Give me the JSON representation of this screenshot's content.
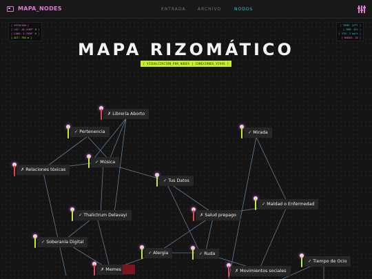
{
  "header": {
    "logo_text": "MAPA_NODES",
    "nav": [
      {
        "label": "ENTRADA",
        "active": false
      },
      {
        "label": "ARCHIVO",
        "active": false
      },
      {
        "label": "NODOS",
        "active": true
      }
    ]
  },
  "info_left": [
    "[ ESTACIÓN ]",
    "[ LAT: 40.4168° N ]",
    "[ LONG: 3.7038° W ]",
    "[ ALT: 750 m ]"
  ],
  "info_right": [
    "[ TEMP: 22ºC ]",
    "[ HUM: 45% ]",
    "[ VTO: 3 km/h ]",
    "[ NODOS: 18 ]"
  ],
  "title": "MAPA RIZOMÁTICO",
  "subtitle": "[ VISUALIZACIÓN_POR_NODOS | CONEXIONES_VIVAS ]",
  "colors": {
    "pink": "#e07bd8",
    "cyan": "#2ec8e8",
    "lime": "#c8f02a",
    "red": "#e8464a"
  },
  "nodes": [
    {
      "label": "Librería Aborto",
      "icon": "✗"
    },
    {
      "label": "Pertenencia",
      "icon": "✓"
    },
    {
      "label": "Mirada",
      "icon": "✓"
    },
    {
      "label": "Música",
      "icon": "✓"
    },
    {
      "label": "Relaciones tóxicas",
      "icon": "✗"
    },
    {
      "label": "Tus Datos",
      "icon": "✓"
    },
    {
      "label": "Maldad o Enfermedad",
      "icon": "✓"
    },
    {
      "label": "Thalictrum Delavayi",
      "icon": "✓"
    },
    {
      "label": "Salud prepago",
      "icon": "✗"
    },
    {
      "label": "Soberanía Digital",
      "icon": "✓"
    },
    {
      "label": "Alergia",
      "icon": "✓"
    },
    {
      "label": "Ruda",
      "icon": "✓"
    },
    {
      "label": "Tiempo de Ocio",
      "icon": "✓"
    },
    {
      "label": "Memes",
      "icon": "✗"
    },
    {
      "label": "Movimientos sociales",
      "icon": "✗"
    }
  ]
}
